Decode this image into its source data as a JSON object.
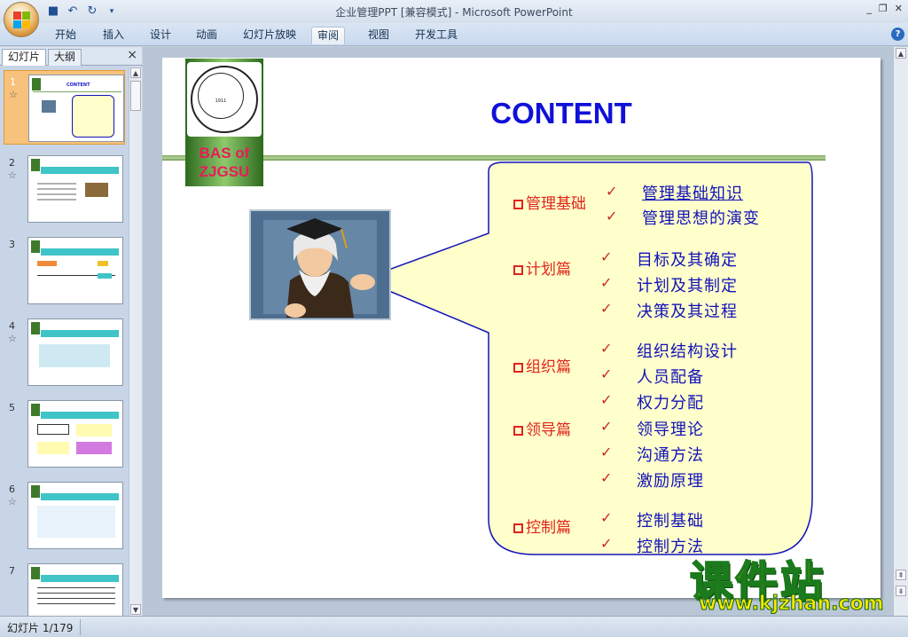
{
  "window": {
    "title": "企业管理PPT [兼容模式] - Microsoft PowerPoint"
  },
  "ribbon": {
    "tabs": [
      "开始",
      "插入",
      "设计",
      "动画",
      "幻灯片放映",
      "审阅",
      "视图",
      "开发工具"
    ],
    "active_tab": "审阅"
  },
  "panel": {
    "tabs": [
      "幻灯片",
      "大纲"
    ],
    "close": "×"
  },
  "thumbnails": [
    {
      "num": "1",
      "star": "☆"
    },
    {
      "num": "2",
      "star": "☆"
    },
    {
      "num": "3",
      "star": ""
    },
    {
      "num": "4",
      "star": "☆"
    },
    {
      "num": "5",
      "star": ""
    },
    {
      "num": "6",
      "star": "☆"
    },
    {
      "num": "7",
      "star": ""
    }
  ],
  "slide": {
    "logo": {
      "year": "1911",
      "text_line1": "BAS of",
      "text_line2": "ZJGSU"
    },
    "title": "CONTENT",
    "sections": [
      {
        "name": "管理基础",
        "items": [
          "管理基础知识",
          "管理思想的演变"
        ]
      },
      {
        "name": "计划篇",
        "items": [
          "目标及其确定",
          "计划及其制定",
          "决策及其过程"
        ]
      },
      {
        "name": "组织篇",
        "items": [
          "组织结构设计",
          "人员配备",
          "权力分配"
        ]
      },
      {
        "name": "领导篇",
        "items": [
          "领导理论",
          "沟通方法",
          "激励原理"
        ]
      },
      {
        "name": "控制篇",
        "items": [
          "控制基础",
          "控制方法"
        ]
      }
    ],
    "check": "✓"
  },
  "watermark": {
    "main": "课件站",
    "url": "www.kjzhan.com"
  },
  "status": {
    "slide_info": "幻灯片 1/179"
  },
  "colors": {
    "title_blue": "#1010d8",
    "section_red": "#e0251b",
    "item_blue": "#1212b8",
    "callout_fill": "#ffffcc",
    "selected_thumb": "#f7c27b"
  }
}
